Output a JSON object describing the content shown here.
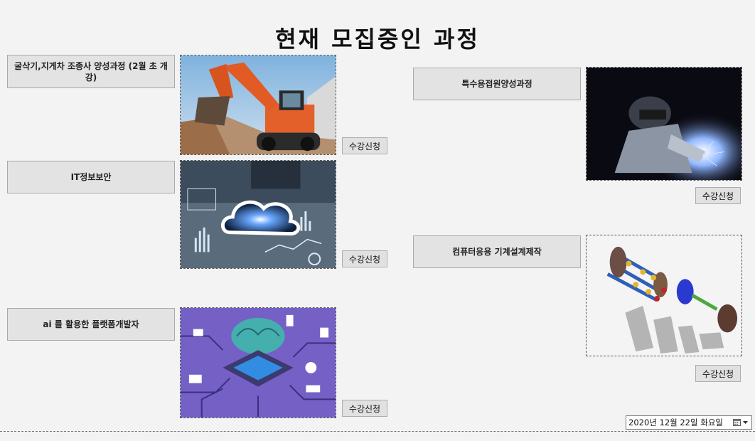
{
  "page": {
    "title": "현재 모집중인 과정"
  },
  "courses": [
    {
      "label": "굴삭기,지게차 조종사 양성과정 (2월 초 개강)",
      "apply": "수강신청",
      "image": "excavator"
    },
    {
      "label": "IT정보보안",
      "apply": "수강신청",
      "image": "cloud-security"
    },
    {
      "label": "ai 를 활용한 플랫폼개발자",
      "apply": "수강신청",
      "image": "ai-chip"
    },
    {
      "label": "특수용접원양성과정",
      "apply": "수강신청",
      "image": "welding"
    },
    {
      "label": "컴퓨터응용 기계설계제작",
      "apply": "수강신청",
      "image": "mechanical-cad"
    }
  ],
  "date_picker": {
    "value": "2020년 12월 22일 화요일",
    "icon": "calendar-dropdown-icon"
  }
}
